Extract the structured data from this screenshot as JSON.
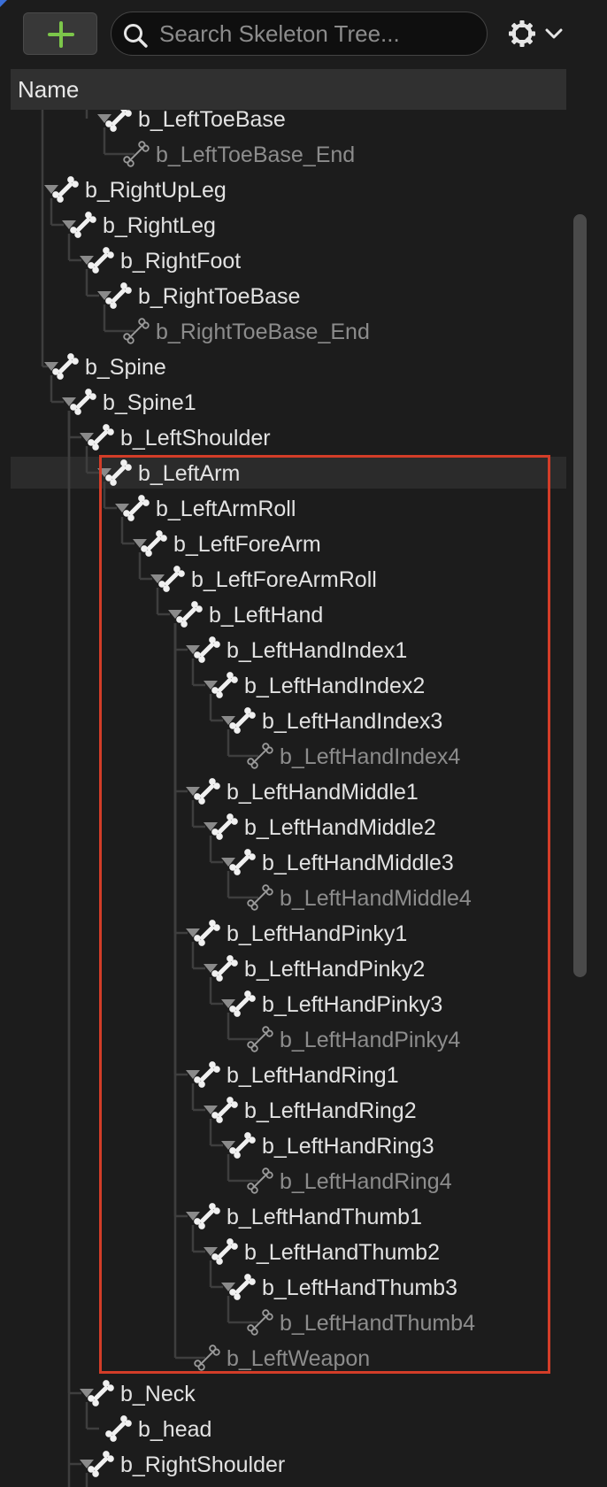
{
  "toolbar": {
    "add_icon": "plus-icon",
    "search_placeholder": "Search Skeleton Tree...",
    "search_icon": "search-icon",
    "settings_icon": "gear-icon",
    "dropdown_icon": "chevron-down-icon"
  },
  "header": {
    "name": "Name"
  },
  "colors": {
    "background": "#1c1c1c",
    "text": "#e2e2e2",
    "dim_text": "#8c8c8c",
    "accent_green": "#7cc64a",
    "highlight_border": "#d33d28"
  },
  "tree": {
    "rows": [
      {
        "label": "b_LeftToeBase",
        "depth": 5,
        "type": "bone",
        "expanded": true
      },
      {
        "label": "b_LeftToeBase_End",
        "depth": 6,
        "type": "end"
      },
      {
        "label": "b_RightUpLeg",
        "depth": 2,
        "type": "bone",
        "expanded": true
      },
      {
        "label": "b_RightLeg",
        "depth": 3,
        "type": "bone",
        "expanded": true
      },
      {
        "label": "b_RightFoot",
        "depth": 4,
        "type": "bone",
        "expanded": true
      },
      {
        "label": "b_RightToeBase",
        "depth": 5,
        "type": "bone",
        "expanded": true
      },
      {
        "label": "b_RightToeBase_End",
        "depth": 6,
        "type": "end"
      },
      {
        "label": "b_Spine",
        "depth": 2,
        "type": "bone",
        "expanded": true
      },
      {
        "label": "b_Spine1",
        "depth": 3,
        "type": "bone",
        "expanded": true
      },
      {
        "label": "b_LeftShoulder",
        "depth": 4,
        "type": "bone",
        "expanded": true
      },
      {
        "label": "b_LeftArm",
        "depth": 5,
        "type": "bone",
        "expanded": true,
        "selected": true
      },
      {
        "label": "b_LeftArmRoll",
        "depth": 6,
        "type": "bone",
        "expanded": true
      },
      {
        "label": "b_LeftForeArm",
        "depth": 7,
        "type": "bone",
        "expanded": true
      },
      {
        "label": "b_LeftForeArmRoll",
        "depth": 8,
        "type": "bone",
        "expanded": true
      },
      {
        "label": "b_LeftHand",
        "depth": 9,
        "type": "bone",
        "expanded": true
      },
      {
        "label": "b_LeftHandIndex1",
        "depth": 10,
        "type": "bone",
        "expanded": true
      },
      {
        "label": "b_LeftHandIndex2",
        "depth": 11,
        "type": "bone",
        "expanded": true
      },
      {
        "label": "b_LeftHandIndex3",
        "depth": 12,
        "type": "bone",
        "expanded": true
      },
      {
        "label": "b_LeftHandIndex4",
        "depth": 13,
        "type": "end"
      },
      {
        "label": "b_LeftHandMiddle1",
        "depth": 10,
        "type": "bone",
        "expanded": true
      },
      {
        "label": "b_LeftHandMiddle2",
        "depth": 11,
        "type": "bone",
        "expanded": true
      },
      {
        "label": "b_LeftHandMiddle3",
        "depth": 12,
        "type": "bone",
        "expanded": true
      },
      {
        "label": "b_LeftHandMiddle4",
        "depth": 13,
        "type": "end"
      },
      {
        "label": "b_LeftHandPinky1",
        "depth": 10,
        "type": "bone",
        "expanded": true
      },
      {
        "label": "b_LeftHandPinky2",
        "depth": 11,
        "type": "bone",
        "expanded": true
      },
      {
        "label": "b_LeftHandPinky3",
        "depth": 12,
        "type": "bone",
        "expanded": true
      },
      {
        "label": "b_LeftHandPinky4",
        "depth": 13,
        "type": "end"
      },
      {
        "label": "b_LeftHandRing1",
        "depth": 10,
        "type": "bone",
        "expanded": true
      },
      {
        "label": "b_LeftHandRing2",
        "depth": 11,
        "type": "bone",
        "expanded": true
      },
      {
        "label": "b_LeftHandRing3",
        "depth": 12,
        "type": "bone",
        "expanded": true
      },
      {
        "label": "b_LeftHandRing4",
        "depth": 13,
        "type": "end"
      },
      {
        "label": "b_LeftHandThumb1",
        "depth": 10,
        "type": "bone",
        "expanded": true
      },
      {
        "label": "b_LeftHandThumb2",
        "depth": 11,
        "type": "bone",
        "expanded": true
      },
      {
        "label": "b_LeftHandThumb3",
        "depth": 12,
        "type": "bone",
        "expanded": true
      },
      {
        "label": "b_LeftHandThumb4",
        "depth": 13,
        "type": "end"
      },
      {
        "label": "b_LeftWeapon",
        "depth": 10,
        "type": "end"
      },
      {
        "label": "b_Neck",
        "depth": 4,
        "type": "bone",
        "expanded": true
      },
      {
        "label": "b_head",
        "depth": 5,
        "type": "bone"
      },
      {
        "label": "b_RightShoulder",
        "depth": 4,
        "type": "bone",
        "expanded": true
      }
    ]
  }
}
